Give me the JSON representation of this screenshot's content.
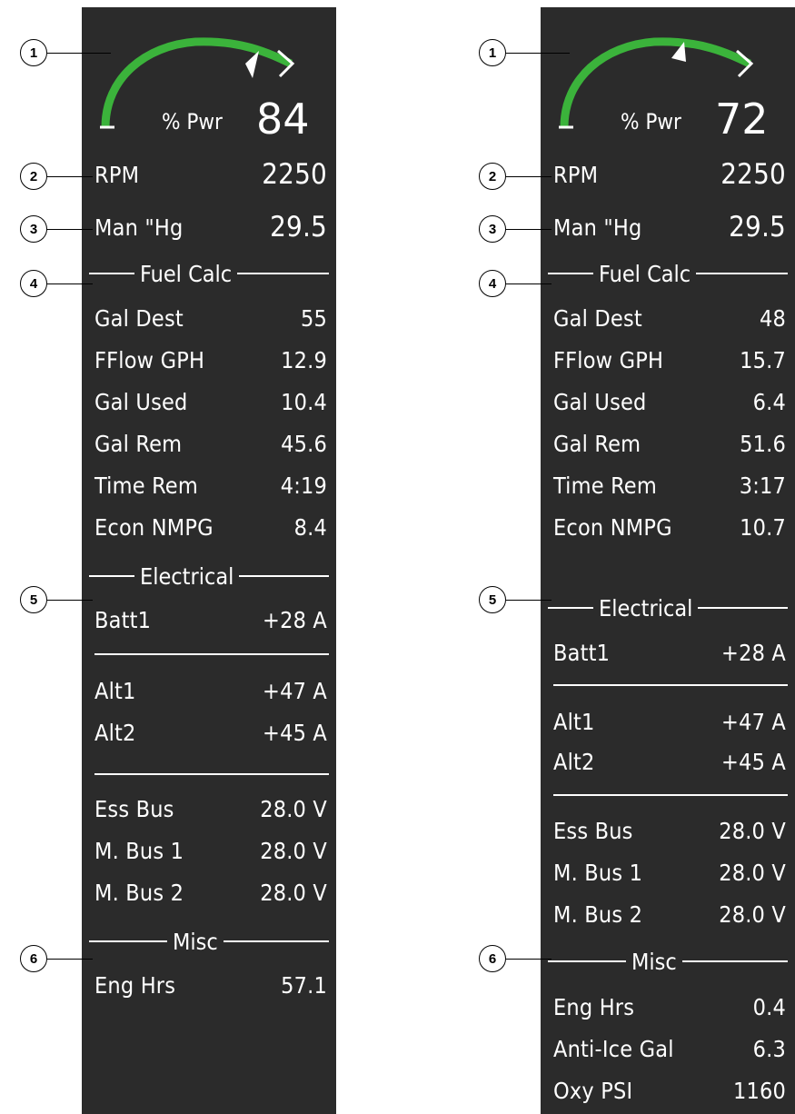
{
  "left": {
    "power": {
      "label": "% Pwr",
      "value": "84",
      "fraction": 0.84
    },
    "rpm": {
      "label": "RPM",
      "value": "2250"
    },
    "man": {
      "label": "Man \"Hg",
      "value": "29.5"
    },
    "fuel_header": "Fuel Calc",
    "fuel": [
      {
        "label": "Gal Dest",
        "value": "55"
      },
      {
        "label": "FFlow GPH",
        "value": "12.9"
      },
      {
        "label": "Gal Used",
        "value": "10.4"
      },
      {
        "label": "Gal Rem",
        "value": "45.6"
      },
      {
        "label": "Time Rem",
        "value": "4:19"
      },
      {
        "label": "Econ NMPG",
        "value": "8.4"
      }
    ],
    "elec_header": "Electrical",
    "batt": {
      "label": "Batt1",
      "value": "+28 A"
    },
    "alt": [
      {
        "label": "Alt1",
        "value": "+47 A"
      },
      {
        "label": "Alt2",
        "value": "+45 A"
      }
    ],
    "bus": [
      {
        "label": "Ess Bus",
        "value": "28.0 V"
      },
      {
        "label": "M. Bus 1",
        "value": "28.0 V"
      },
      {
        "label": "M. Bus 2",
        "value": "28.0 V"
      }
    ],
    "misc_header": "Misc",
    "misc": [
      {
        "label": "Eng Hrs",
        "value": "57.1"
      }
    ]
  },
  "right": {
    "power": {
      "label": "% Pwr",
      "value": "72",
      "fraction": 0.72
    },
    "rpm": {
      "label": "RPM",
      "value": "2250"
    },
    "man": {
      "label": "Man \"Hg",
      "value": "29.5"
    },
    "fuel_header": "Fuel Calc",
    "fuel": [
      {
        "label": "Gal Dest",
        "value": "48"
      },
      {
        "label": "FFlow GPH",
        "value": "15.7"
      },
      {
        "label": "Gal Used",
        "value": "6.4"
      },
      {
        "label": "Gal Rem",
        "value": "51.6"
      },
      {
        "label": "Time Rem",
        "value": "3:17"
      },
      {
        "label": "Econ NMPG",
        "value": "10.7"
      }
    ],
    "elec_header": "Electrical",
    "batt": {
      "label": "Batt1",
      "value": "+28 A"
    },
    "alt": [
      {
        "label": "Alt1",
        "value": "+47 A"
      },
      {
        "label": "Alt2",
        "value": "+45 A"
      }
    ],
    "bus": [
      {
        "label": "Ess Bus",
        "value": "28.0 V"
      },
      {
        "label": "M. Bus 1",
        "value": "28.0 V"
      },
      {
        "label": "M. Bus 2",
        "value": "28.0 V"
      }
    ],
    "misc_header": "Misc",
    "misc": [
      {
        "label": "Eng Hrs",
        "value": "0.4"
      },
      {
        "label": "Anti-Ice Gal",
        "value": "6.3"
      },
      {
        "label": "Oxy PSI",
        "value": "1160"
      }
    ]
  },
  "callouts": [
    "1",
    "2",
    "3",
    "4",
    "5",
    "6"
  ],
  "colors": {
    "panel": "#2b2b2b",
    "arc": "#3bb33b",
    "text": "#ffffff"
  }
}
